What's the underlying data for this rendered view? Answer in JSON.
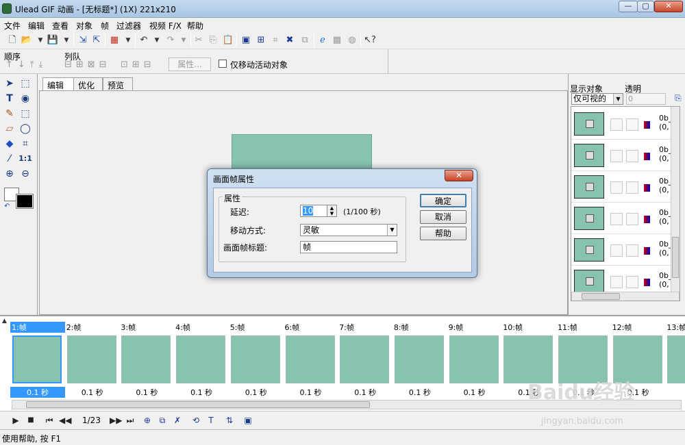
{
  "window": {
    "title": "Ulead GIF 动画 - [无标题*] (1X) 221x210",
    "controls": [
      "—",
      "▢",
      "✕"
    ]
  },
  "menu": [
    "文件",
    "编辑",
    "查看",
    "对象",
    "帧",
    "过滤器",
    "视频 F/X",
    "帮助"
  ],
  "toolbar2": {
    "order_label": "顺序",
    "queue_label": "列队",
    "properties_button": "属性...",
    "move_active_only": "仅移动活动对象"
  },
  "edit_tabs": [
    "编辑",
    "优化",
    "预览"
  ],
  "right_panel": {
    "show_objects_label": "显示对象",
    "transparency_label": "透明",
    "show_select_value": "仅可视的",
    "transparency_value": "0",
    "object_text_1": "0b_",
    "object_text_2": "(0,"
  },
  "frames": [
    {
      "label": "1:帧",
      "duration": "0.1 秒"
    },
    {
      "label": "2:帧",
      "duration": "0.1 秒"
    },
    {
      "label": "3:帧",
      "duration": "0.1 秒"
    },
    {
      "label": "4:帧",
      "duration": "0.1 秒"
    },
    {
      "label": "5:帧",
      "duration": "0.1 秒"
    },
    {
      "label": "6:帧",
      "duration": "0.1 秒"
    },
    {
      "label": "7:帧",
      "duration": "0.1 秒"
    },
    {
      "label": "8:帧",
      "duration": "0.1 秒"
    },
    {
      "label": "9:帧",
      "duration": "0.1 秒"
    },
    {
      "label": "10:帧",
      "duration": "0.1 秒"
    },
    {
      "label": "11:帧",
      "duration": "0.1 秒"
    },
    {
      "label": "12:帧",
      "duration": "0.1 秒"
    },
    {
      "label": "13:帧",
      "duration": ""
    }
  ],
  "playback": {
    "frame_counter": "1/23"
  },
  "status": "使用帮助, 按 F1",
  "dialog": {
    "title": "画面帧属性",
    "group_label": "属性",
    "delay_label": "延迟:",
    "delay_value": "10",
    "delay_unit": "(1/100 秒)",
    "method_label": "移动方式:",
    "method_value": "灵敏",
    "frame_title_label": "画面帧标题:",
    "frame_title_value": "帧",
    "ok_button": "确定",
    "cancel_button": "取消",
    "help_button": "帮助"
  },
  "watermark": {
    "brand": "Baidu经验",
    "url": "jingyan.baidu.com"
  },
  "colors": {
    "frame_fill": "#87c3ad",
    "selection": "#3399ff"
  }
}
